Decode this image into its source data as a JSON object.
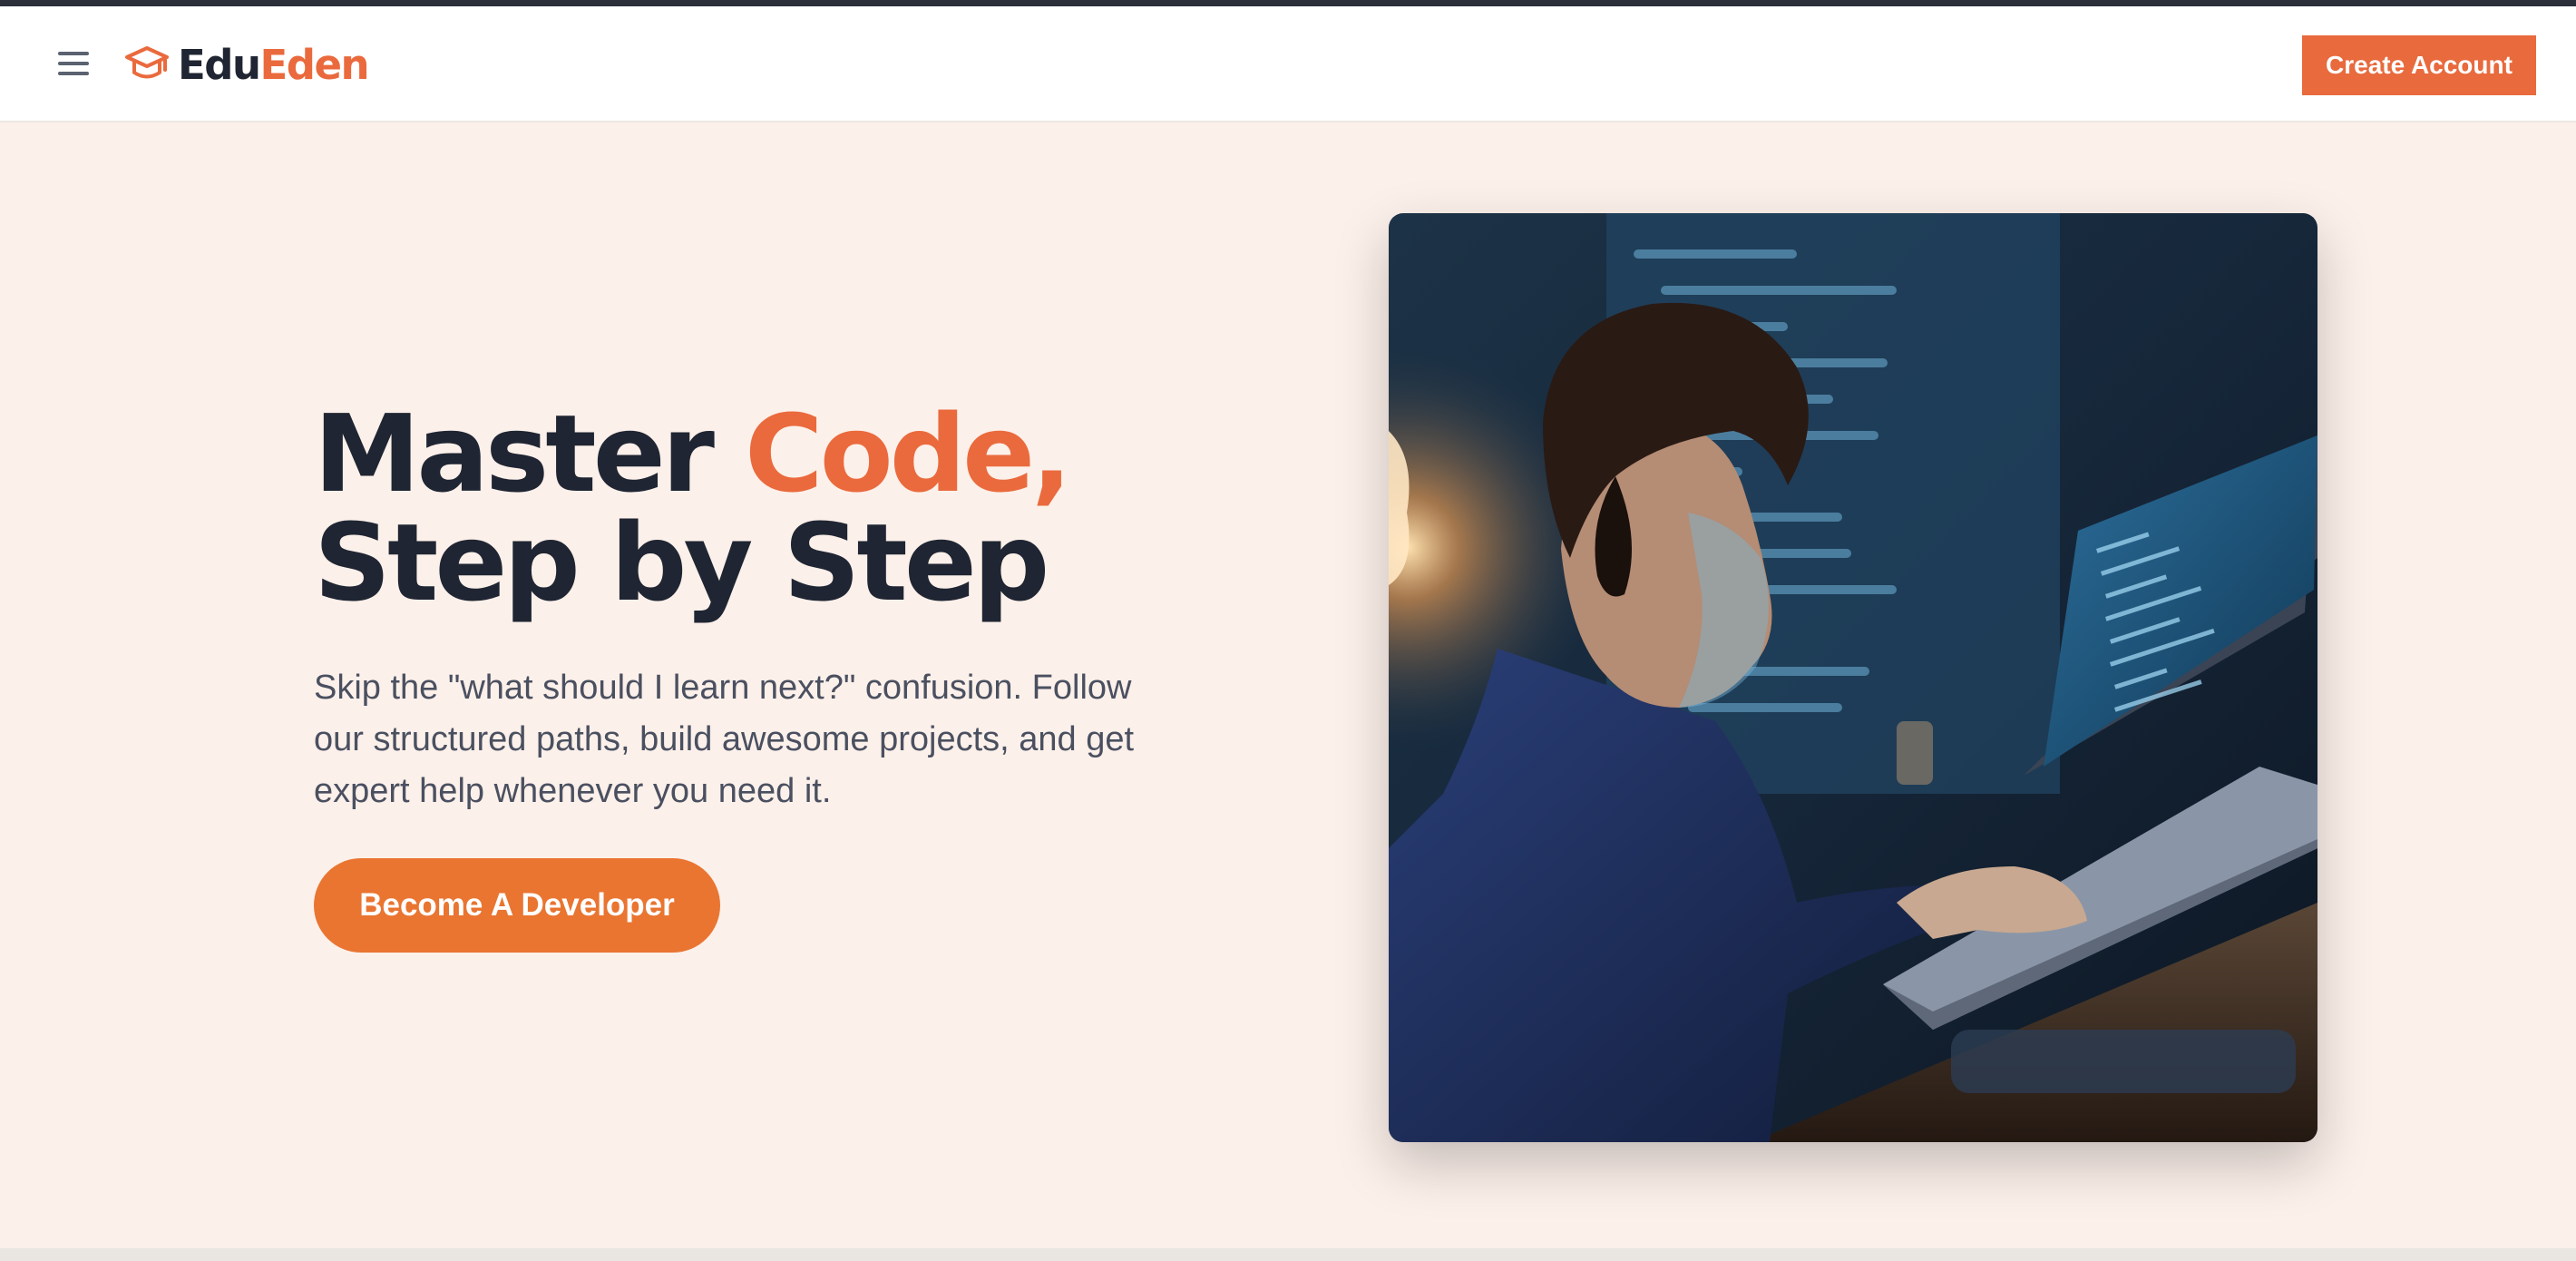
{
  "header": {
    "menu_icon": "hamburger-menu-icon",
    "logo_icon": "graduation-cap-icon",
    "logo_part1": "Edu",
    "logo_part2": "Eden",
    "create_account_label": "Create Account"
  },
  "hero": {
    "headline_line1_plain": "Master ",
    "headline_line1_accent": "Code,",
    "headline_line2": "Step by Step",
    "subtext": "Skip the \"what should I learn next?\" confusion. Follow our structured paths, build awesome projects, and get expert help whenever you need it.",
    "cta_label": "Become A Developer",
    "image_description_icon": "boy-coding-on-laptop-photo"
  },
  "colors": {
    "accent": "#ea6a3d",
    "button": "#e97531",
    "dark_text": "#1f2532",
    "background": "#fcf0ea"
  }
}
